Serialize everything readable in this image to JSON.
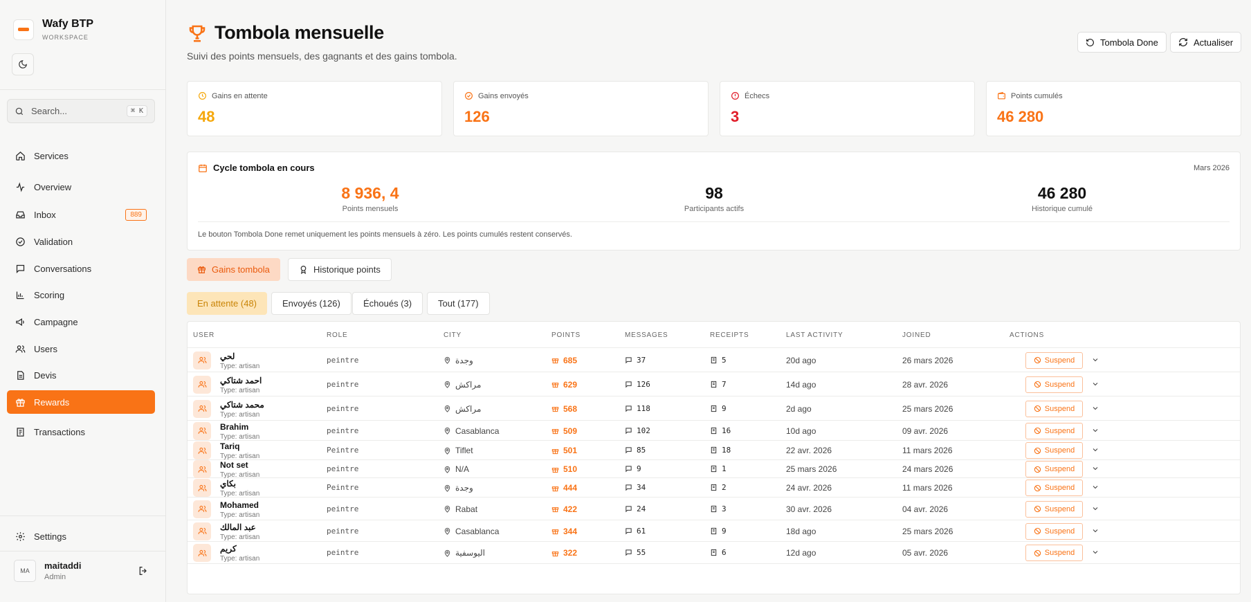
{
  "brand": {
    "name": "Wafy BTP",
    "subtitle": "WORKSPACE"
  },
  "search": {
    "placeholder": "Search...",
    "shortcut": "⌘ K"
  },
  "nav": [
    {
      "label": "Services",
      "icon": "home-icon"
    },
    {
      "label": "Overview",
      "icon": "activity-icon"
    },
    {
      "label": "Inbox",
      "icon": "inbox-icon",
      "badge": "889"
    },
    {
      "label": "Validation",
      "icon": "check-circle-icon"
    },
    {
      "label": "Conversations",
      "icon": "message-icon"
    },
    {
      "label": "Scoring",
      "icon": "bar-chart-icon"
    },
    {
      "label": "Campagne",
      "icon": "megaphone-icon"
    },
    {
      "label": "Users",
      "icon": "users-icon"
    },
    {
      "label": "Devis",
      "icon": "file-icon"
    },
    {
      "label": "Rewards",
      "icon": "gift-icon",
      "active": true
    },
    {
      "label": "Transactions",
      "icon": "receipt-icon"
    }
  ],
  "settings": {
    "label": "Settings"
  },
  "user": {
    "initials": "MA",
    "name": "maitaddi",
    "role": "Admin"
  },
  "header": {
    "title": "Tombola mensuelle",
    "subtitle": "Suivi des points mensuels, des gagnants et des gains tombola.",
    "btn_done": "Tombola Done",
    "btn_refresh": "Actualiser"
  },
  "stats": [
    {
      "label": "Gains en attente",
      "value": "48",
      "color": "#f5a70a"
    },
    {
      "label": "Gains envoyés",
      "value": "126",
      "color": "#f97316"
    },
    {
      "label": "Échecs",
      "value": "3",
      "color": "#e11d2a"
    },
    {
      "label": "Points cumulés",
      "value": "46 280",
      "color": "#f97316"
    }
  ],
  "cycle": {
    "title": "Cycle tombola en cours",
    "month": "Mars 2026",
    "metrics": [
      {
        "value": "8 936, 4",
        "label": "Points mensuels"
      },
      {
        "value": "98",
        "label": "Participants actifs"
      },
      {
        "value": "46 280",
        "label": "Historique cumulé"
      }
    ],
    "note": "Le bouton Tombola Done remet uniquement les points mensuels à zéro. Les points cumulés restent conservés."
  },
  "tabs": [
    "Gains tombola",
    "Historique points"
  ],
  "filters": [
    "En attente (48)",
    "Envoyés (126)",
    "Échoués (3)",
    "Tout (177)"
  ],
  "table": {
    "columns": [
      "USER",
      "ROLE",
      "CITY",
      "POINTS",
      "MESSAGES",
      "RECEIPTS",
      "LAST ACTIVITY",
      "JOINED",
      "ACTIONS"
    ],
    "action_label": "Suspend",
    "rows": [
      {
        "name": "لحي",
        "type": "Type: artisan",
        "role": "peintre",
        "city": "وجدة",
        "points": "685",
        "messages": "37",
        "receipts": "5",
        "last": "20d ago",
        "joined": "26 mars 2026"
      },
      {
        "name": "احمد شتاكي",
        "type": "Type: artisan",
        "role": "peintre",
        "city": "مراكش",
        "points": "629",
        "messages": "126",
        "receipts": "7",
        "last": "14d ago",
        "joined": "28 avr. 2026"
      },
      {
        "name": "محمد شتاكي",
        "type": "Type: artisan",
        "role": "peintre",
        "city": "مراكش",
        "points": "568",
        "messages": "118",
        "receipts": "9",
        "last": "2d ago",
        "joined": "25 mars 2026"
      },
      {
        "name": "Brahim",
        "type": "Type: artisan",
        "role": "peintre",
        "city": "Casablanca",
        "points": "509",
        "messages": "102",
        "receipts": "16",
        "last": "10d ago",
        "joined": "09 avr. 2026"
      },
      {
        "name": "Tariq",
        "type": "Type: artisan",
        "role": "Peintre",
        "city": "Tiflet",
        "points": "501",
        "messages": "85",
        "receipts": "18",
        "last": "22 avr. 2026",
        "joined": "11 mars 2026"
      },
      {
        "name": "Not set",
        "type": "Type: artisan",
        "role": "peintre",
        "city": "N/A",
        "points": "510",
        "messages": "9",
        "receipts": "1",
        "last": "25 mars 2026",
        "joined": "24 mars 2026"
      },
      {
        "name": "بكاي",
        "type": "Type: artisan",
        "role": "Peintre",
        "city": "وجدة",
        "points": "444",
        "messages": "34",
        "receipts": "2",
        "last": "24 avr. 2026",
        "joined": "11 mars 2026"
      },
      {
        "name": "Mohamed",
        "type": "Type: artisan",
        "role": "peintre",
        "city": "Rabat",
        "points": "422",
        "messages": "24",
        "receipts": "3",
        "last": "30 avr. 2026",
        "joined": "04 avr. 2026"
      },
      {
        "name": "عبد المالك",
        "type": "Type: artisan",
        "role": "peintre",
        "city": "Casablanca",
        "points": "344",
        "messages": "61",
        "receipts": "9",
        "last": "18d ago",
        "joined": "25 mars 2026"
      },
      {
        "name": "كريم",
        "type": "Type: artisan",
        "role": "peintre",
        "city": "اليوسفية",
        "points": "322",
        "messages": "55",
        "receipts": "6",
        "last": "12d ago",
        "joined": "05 avr. 2026"
      }
    ]
  },
  "colors": {
    "accent": "#f97316",
    "pending": "#f5a70a",
    "danger": "#e11d2a"
  }
}
